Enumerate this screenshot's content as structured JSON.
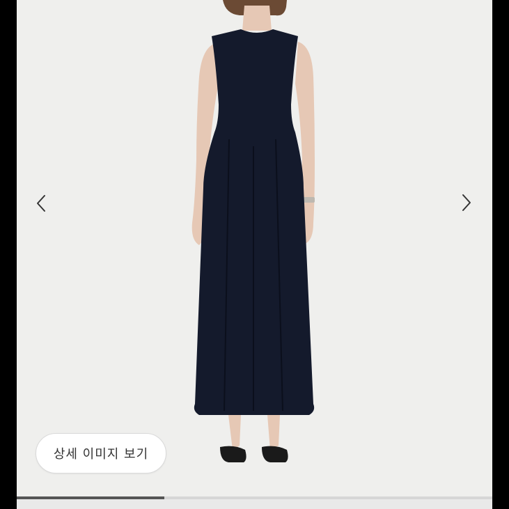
{
  "gallery": {
    "detail_button_label": "상세 이미지 보기",
    "progress_fraction": 0.31,
    "prev_icon": "chevron-left-icon",
    "next_icon": "chevron-right-icon"
  },
  "photo": {
    "subject": "model-in-sleeveless-navy-maxi-dress",
    "colors": {
      "background": "#efefed",
      "dress": "#141a2c",
      "skin": "#e6c8b5",
      "hair": "#6b4a34",
      "sandals": "#1a1a1a"
    }
  }
}
